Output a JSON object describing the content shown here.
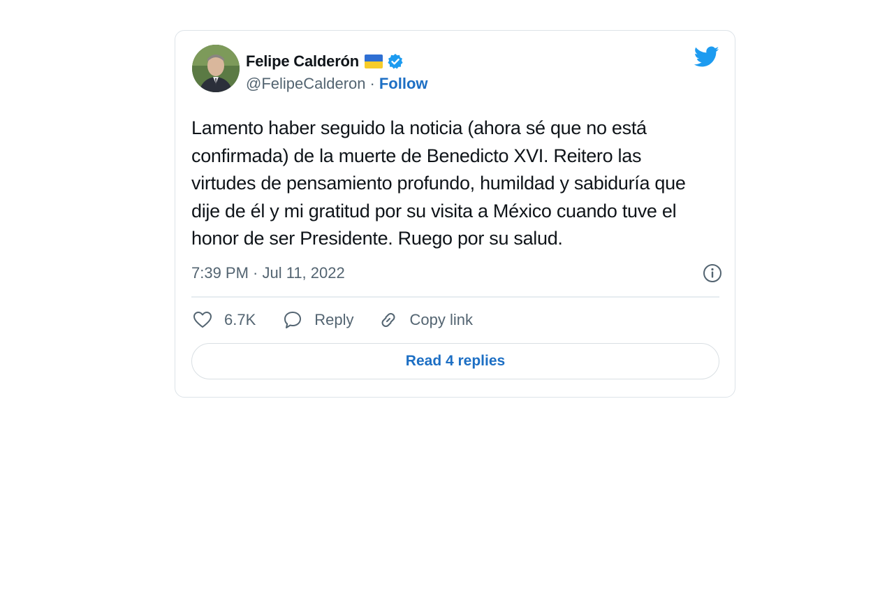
{
  "tweet": {
    "author": {
      "display_name": "Felipe Calderón",
      "handle": "@FelipeCalderon",
      "separator": "·",
      "follow_label": "Follow",
      "verified": true,
      "flag": "ukraine-flag"
    },
    "text": "Lamento haber seguido la noticia (ahora sé que no está confirmada) de la muerte de Benedicto XVI. Reitero las virtudes de pensamiento profundo, humildad y sabiduría que dije de él y mi gratitud por su visita a México cuando tuve el honor de ser Presidente. Ruego por su salud.",
    "timestamp": "7:39 PM · Jul 11, 2022",
    "actions": {
      "like_count": "6.7K",
      "reply_label": "Reply",
      "copy_link_label": "Copy link"
    },
    "read_replies_label": "Read 4 replies"
  },
  "icons": {
    "brand": "twitter-bird-icon",
    "info": "info-icon",
    "like": "heart-icon",
    "reply": "speech-bubble-icon",
    "copy_link": "link-icon"
  },
  "colors": {
    "twitter_blue": "#1d9bf0",
    "link_blue": "#1d6fc4",
    "secondary_text": "#536471",
    "primary_text": "#0f1419",
    "border": "#dde3e8"
  }
}
